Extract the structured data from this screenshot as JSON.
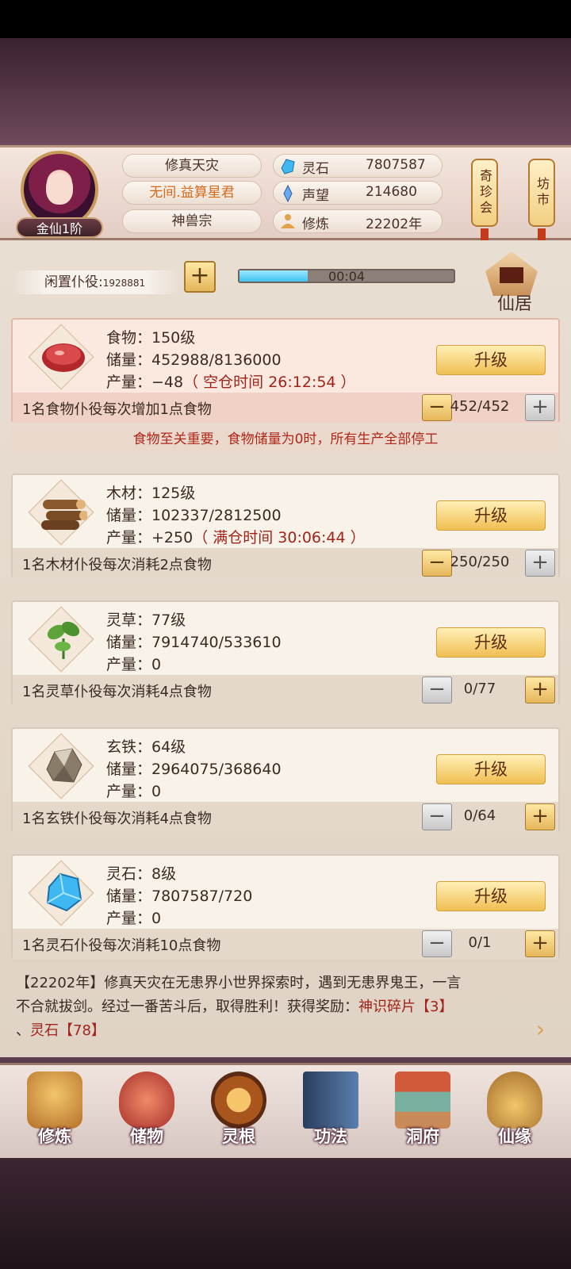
{
  "player": {
    "rank": "金仙1阶",
    "event": "修真天灾",
    "title": "无间.益算星君",
    "sect": "神兽宗",
    "stats": [
      {
        "icon": "spirit-stone-icon",
        "label": "灵石",
        "value": "7807587"
      },
      {
        "icon": "reputation-icon",
        "label": "声望",
        "value": "214680"
      },
      {
        "icon": "cultivation-icon",
        "label": "修炼",
        "value": "22202年"
      }
    ],
    "side_buttons": [
      "奇珍会",
      "坊市"
    ]
  },
  "idle": {
    "label": "闲置仆役:",
    "count": "1928881",
    "timer": "00:04",
    "progress": 0.32
  },
  "residence_label": "仙居",
  "upgrade_label": "升级",
  "resources": [
    {
      "id": "food",
      "icon": "meat-icon",
      "name": "食物：150级",
      "storage": "储量：452988/8136000",
      "output": "产量：−48",
      "output_note": "（ 空仓时间 26:12:54 ）",
      "desc": "1名食物仆役每次增加1点食物",
      "workers": "452/452"
    },
    {
      "id": "wood",
      "icon": "logs-icon",
      "name": "木材：125级",
      "storage": "储量：102337/2812500",
      "output": "产量：+250",
      "output_note": "（ 满仓时间 30:06:44 ）",
      "desc": "1名木材仆役每次消耗2点食物",
      "workers": "250/250"
    },
    {
      "id": "herb",
      "icon": "herb-leaf-icon",
      "name": "灵草：77级",
      "storage": "储量：7914740/533610",
      "output": "产量：0",
      "output_note": "",
      "desc": "1名灵草仆役每次消耗4点食物",
      "workers": "0/77"
    },
    {
      "id": "iron",
      "icon": "iron-ore-icon",
      "name": "玄铁：64级",
      "storage": "储量：2964075/368640",
      "output": "产量：0",
      "output_note": "",
      "desc": "1名玄铁仆役每次消耗4点食物",
      "workers": "0/64"
    },
    {
      "id": "stone",
      "icon": "crystal-icon",
      "name": "灵石：8级",
      "storage": "储量：7807587/720",
      "output": "产量：0",
      "output_note": "",
      "desc": "1名灵石仆役每次消耗10点食物",
      "workers": "0/1"
    }
  ],
  "food_notice": "食物至关重要，食物储量为0时，所有生产全部停工",
  "log": {
    "line1": "【22202年】修真天灾在无患界小世界探索时，遇到无患界鬼王，一言",
    "line2_a": "不合就拔剑。经过一番苦斗后，取得胜利！获得奖励：",
    "line2_b": "神识碎片【3】",
    "line3_a": "、",
    "line3_b": "灵石【78】"
  },
  "nav": [
    {
      "icon": "cultivate-icon",
      "label": "修炼",
      "color": "#d48a2e"
    },
    {
      "icon": "storage-bag-icon",
      "label": "储物",
      "color": "#d04a3a"
    },
    {
      "icon": "spirit-root-icon",
      "label": "灵根",
      "color": "#b0661e"
    },
    {
      "icon": "skill-book-icon",
      "label": "功法",
      "color": "#3c5e8a"
    },
    {
      "icon": "cave-dwelling-icon",
      "label": "洞府",
      "color": "#a8683a"
    },
    {
      "icon": "fate-icon",
      "label": "仙缘",
      "color": "#c98a3a"
    }
  ],
  "colors": {
    "accent_gold": "#f0bf52",
    "warn_red": "#a0241a",
    "progress_blue": "#3ec3ef"
  }
}
